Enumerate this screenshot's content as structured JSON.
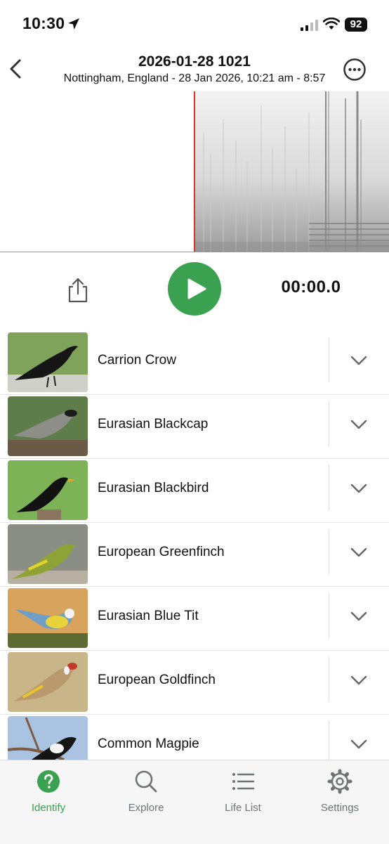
{
  "status_bar": {
    "time": "10:30",
    "battery": "92"
  },
  "header": {
    "title": "2026-01-28 1021",
    "subtitle": "Nottingham, England - 28 Jan 2026, 10:21 am - 8:57"
  },
  "player": {
    "timer": "00:00.0"
  },
  "species": [
    {
      "name": "Carrion Crow"
    },
    {
      "name": "Eurasian Blackcap"
    },
    {
      "name": "Eurasian Blackbird"
    },
    {
      "name": "European Greenfinch"
    },
    {
      "name": "Eurasian Blue Tit"
    },
    {
      "name": "European Goldfinch"
    },
    {
      "name": "Common Magpie"
    }
  ],
  "tabs": [
    {
      "label": "Identify",
      "icon": "question-circle-icon",
      "active": true
    },
    {
      "label": "Explore",
      "icon": "search-icon"
    },
    {
      "label": "Life List",
      "icon": "list-icon"
    },
    {
      "label": "Settings",
      "icon": "gear-icon"
    }
  ],
  "colors": {
    "accent": "#3aa150",
    "playhead": "#e0302a"
  }
}
